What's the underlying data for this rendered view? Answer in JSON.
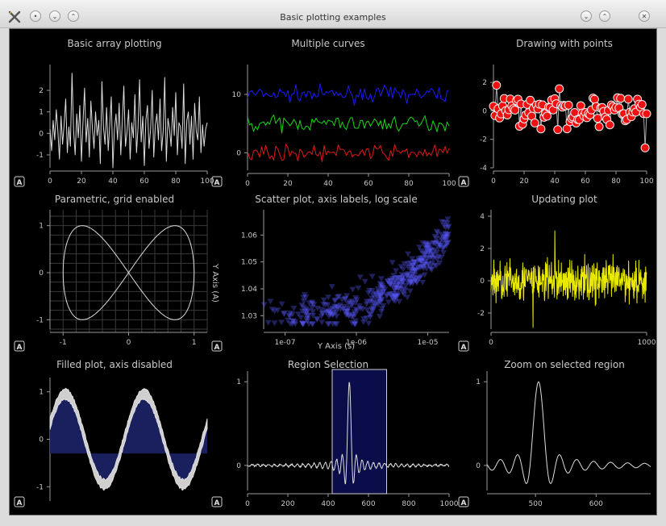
{
  "window": {
    "title": "Basic plotting examples",
    "controls": [
      "close-icon",
      "minimize-icon",
      "maximize-icon"
    ]
  },
  "colors": {
    "axis": "#9a9a9a",
    "text": "#c8c8c8",
    "white": "#dddddd",
    "blue": "#1a1aff",
    "green": "#18d818",
    "red": "#e01818",
    "yellow": "#e8e800",
    "scatter": "#5a5aff",
    "fill": "#1a1f5e"
  },
  "auto_button": "A",
  "chart_data": [
    {
      "type": "line",
      "title": "Basic array plotting",
      "xlim": [
        0,
        100
      ],
      "ylim": [
        -1.6,
        2.9
      ],
      "xticks": [
        "0",
        "20",
        "40",
        "60",
        "80",
        "100"
      ],
      "yticks": [
        "-1",
        "0",
        "1",
        "2"
      ],
      "series": [
        {
          "color": "#dddddd",
          "values": [
            0.2,
            -0.8,
            0.6,
            -0.3,
            1.1,
            0.1,
            -1.2,
            0.8,
            -0.5,
            0.4,
            1.6,
            -0.9,
            0.3,
            -0.6,
            2.8,
            0.1,
            -1.0,
            0.9,
            -0.2,
            1.3,
            -1.3,
            0.5,
            2.1,
            -0.4,
            0.7,
            -1.1,
            1.5,
            0.2,
            -0.7,
            1.0,
            -0.1,
            0.6,
            -1.4,
            2.4,
            0.3,
            -0.5,
            1.2,
            -0.8,
            0.4,
            1.7,
            -1.6,
            0.2,
            0.9,
            -0.3,
            1.4,
            -1.0,
            0.6,
            2.2,
            -0.6,
            0.1,
            1.1,
            -1.2,
            0.5,
            -0.2,
            1.8,
            -0.9,
            0.3,
            2.5,
            -0.4,
            0.8,
            -1.5,
            0.6,
            1.3,
            -0.7,
            0.2,
            2.0,
            -1.1,
            0.4,
            0.9,
            -0.3,
            1.6,
            -0.8,
            0.1,
            2.6,
            -1.3,
            0.7,
            0.2,
            -0.6,
            1.2,
            -0.1,
            1.9,
            -1.0,
            0.5,
            0.3,
            -0.7,
            2.3,
            -1.4,
            0.6,
            1.0,
            -0.5,
            0.8,
            -1.2,
            1.4,
            0.1,
            -0.3,
            1.7,
            -0.9,
            0.4,
            -0.6,
            0.2,
            0.5
          ]
        }
      ]
    },
    {
      "type": "line",
      "title": "Multiple curves",
      "xlim": [
        0,
        100
      ],
      "ylim": [
        -3,
        14
      ],
      "xticks": [
        "0",
        "20",
        "40",
        "60",
        "80",
        "100"
      ],
      "yticks": [
        "0",
        "10"
      ],
      "series": [
        {
          "name": "blue",
          "offset": 10,
          "color": "#1a1aff"
        },
        {
          "name": "green",
          "offset": 5,
          "color": "#18d818"
        },
        {
          "name": "red",
          "offset": 0,
          "color": "#e01818"
        }
      ]
    },
    {
      "type": "scatter",
      "title": "Drawing with points",
      "xlim": [
        0,
        100
      ],
      "ylim": [
        -4,
        2.8
      ],
      "xticks": [
        "0",
        "20",
        "40",
        "60",
        "80",
        "100"
      ],
      "yticks": [
        "-4",
        "-2",
        "0",
        "2"
      ]
    },
    {
      "type": "line",
      "title": "Parametric, grid enabled",
      "xlim": [
        -1.2,
        1.2
      ],
      "ylim": [
        -1.2,
        1.2
      ],
      "xticks": [
        "-1",
        "0",
        "1"
      ],
      "yticks": [
        "-1",
        "0",
        "1"
      ],
      "grid": true
    },
    {
      "type": "scatter",
      "title": "Scatter plot, axis labels, log scale",
      "xlabel": "Y Axis (s)",
      "ylabel": "Y Axis (A)",
      "xlog": true,
      "xticks": [
        "1e-07",
        "1e-06",
        "1e-05"
      ],
      "yticks": [
        "1.03",
        "1.04",
        "1.05",
        "1.06"
      ]
    },
    {
      "type": "line",
      "title": "Updating plot",
      "xlim": [
        0,
        1000
      ],
      "ylim": [
        -3,
        4
      ],
      "xticks": [
        "0",
        "1000"
      ],
      "yticks": [
        "-2",
        "0",
        "2",
        "4"
      ]
    },
    {
      "type": "area",
      "title": "Filled plot, axis disabled",
      "yticks": [
        "-1",
        "0",
        "1"
      ]
    },
    {
      "type": "line",
      "title": "Region Selection",
      "xlim": [
        0,
        1000
      ],
      "ylim": [
        -0.3,
        1.05
      ],
      "xticks": [
        "0",
        "200",
        "400",
        "600",
        "800",
        "1000"
      ],
      "yticks": [
        "0",
        "1"
      ],
      "region": [
        420,
        690
      ]
    },
    {
      "type": "line",
      "title": "Zoom on selected region",
      "xlim": [
        420,
        690
      ],
      "ylim": [
        -0.3,
        1.05
      ],
      "xticks": [
        "500",
        "600"
      ],
      "yticks": [
        "0",
        "1"
      ]
    }
  ]
}
